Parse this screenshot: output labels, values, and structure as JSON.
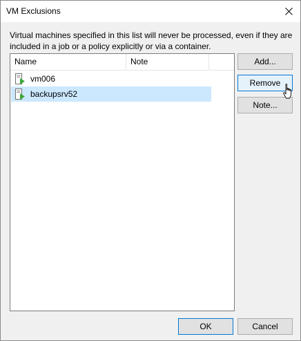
{
  "window": {
    "title": "VM Exclusions"
  },
  "description": "Virtual machines specified in this list will never be processed, even if they are included in a job or a policy explicitly or via a container.",
  "list": {
    "columns": [
      "Name",
      "Note"
    ],
    "rows": [
      {
        "name": "vm006",
        "note": "",
        "selected": false
      },
      {
        "name": "backupsrv52",
        "note": "",
        "selected": true
      }
    ]
  },
  "buttons": {
    "add": "Add...",
    "remove": "Remove",
    "note": "Note...",
    "ok": "OK",
    "cancel": "Cancel"
  },
  "icons": {
    "close": "close-icon",
    "vm": "vm-icon",
    "cursor": "hand-cursor-icon"
  },
  "colors": {
    "selection": "#cce8ff",
    "accent": "#0078d7",
    "vm_icon_green": "#3aa935"
  }
}
